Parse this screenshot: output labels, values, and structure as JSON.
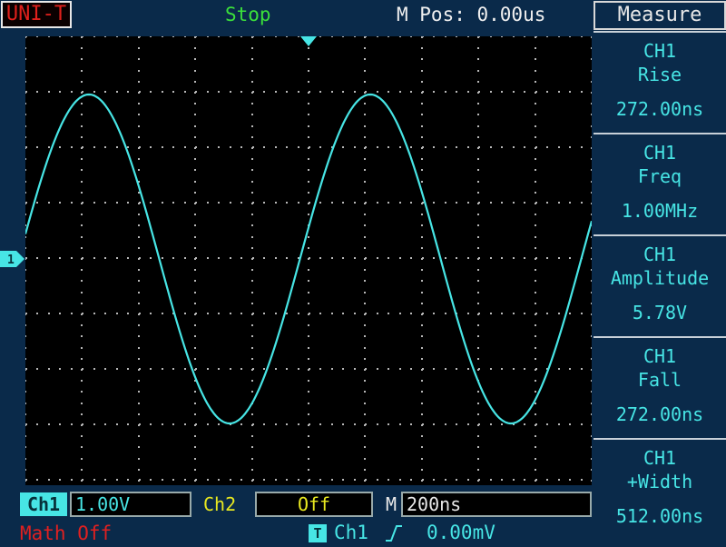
{
  "header": {
    "brand": "UNI-T",
    "run_state": "Stop",
    "m_pos": "M Pos: 0.00us"
  },
  "measure": {
    "title": "Measure",
    "items": [
      {
        "channel": "CH1",
        "name": "Rise",
        "value": "272.00ns"
      },
      {
        "channel": "CH1",
        "name": "Freq",
        "value": "1.00MHz"
      },
      {
        "channel": "CH1",
        "name": "Amplitude",
        "value": "5.78V"
      },
      {
        "channel": "CH1",
        "name": "Fall",
        "value": "272.00ns"
      },
      {
        "channel": "CH1",
        "name": "+Width",
        "value": "512.00ns"
      }
    ]
  },
  "footer": {
    "ch1_label": "Ch1",
    "ch1_scale": "1.00V",
    "ch2_label": "Ch2",
    "ch2_scale": "Off",
    "m_label": "M",
    "timebase": "200ns",
    "math": "Math Off",
    "trigger_badge": "T",
    "trigger_source": "Ch1",
    "trigger_level": "0.00mV"
  },
  "screen": {
    "channel_marker": "1"
  },
  "colors": {
    "trace": "#47e5e5",
    "run_state": "#3be03b",
    "brand": "#e0201c",
    "ch2": "#e8e820",
    "math": "#e02020",
    "background": "#0a2a4a"
  }
}
